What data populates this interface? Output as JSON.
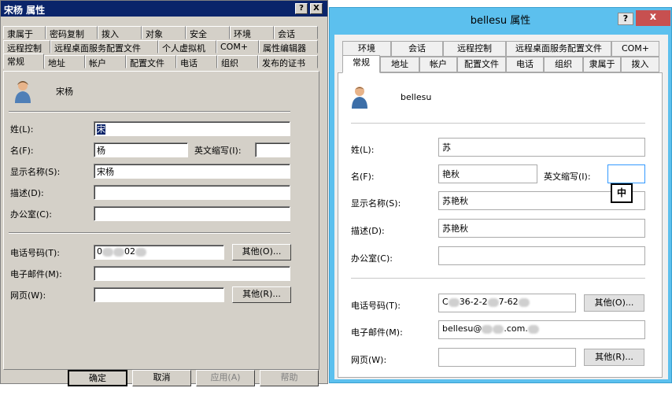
{
  "left": {
    "title": "宋杨 属性",
    "help_btn": "?",
    "close_btn": "X",
    "tabs_row1": [
      "隶属于",
      "密码复制",
      "拨入",
      "对象",
      "安全",
      "环境",
      "会话"
    ],
    "tabs_row2": [
      "远程控制",
      "远程桌面服务配置文件",
      "个人虚拟机",
      "COM+",
      "属性编辑器"
    ],
    "tabs_row3": [
      "常规",
      "地址",
      "帐户",
      "配置文件",
      "电话",
      "组织",
      "发布的证书"
    ],
    "display_name": "宋杨",
    "labels": {
      "last": "姓(L):",
      "first": "名(F):",
      "initials": "英文缩写(I):",
      "display": "显示名称(S):",
      "desc": "描述(D):",
      "office": "办公室(C):",
      "phone": "电话号码(T):",
      "email": "电子邮件(M):",
      "web": "网页(W):"
    },
    "values": {
      "last": "宋",
      "first": "杨",
      "initials": "",
      "display": "宋杨",
      "desc": "",
      "office": "",
      "phone_a": "0",
      "phone_b": "02",
      "email": "",
      "web": ""
    },
    "other1": "其他(O)...",
    "other2": "其他(R)...",
    "bottom_buttons": [
      "确定",
      "取消",
      "应用(A)",
      "帮助"
    ]
  },
  "right": {
    "title": "bellesu 属性",
    "help_btn": "?",
    "close_btn": "x",
    "tabs_row1": [
      "环境",
      "会话",
      "远程控制",
      "远程桌面服务配置文件",
      "COM+"
    ],
    "tabs_row2": [
      "常规",
      "地址",
      "帐户",
      "配置文件",
      "电话",
      "组织",
      "隶属于",
      "拨入"
    ],
    "display_name": "bellesu",
    "labels": {
      "last": "姓(L):",
      "first": "名(F):",
      "initials": "英文缩写(I):",
      "display": "显示名称(S):",
      "desc": "描述(D):",
      "office": "办公室(C):",
      "phone": "电话号码(T):",
      "email": "电子邮件(M):",
      "web": "网页(W):"
    },
    "values": {
      "last": "苏",
      "first": "艳秋",
      "initials": "",
      "display": "苏艳秋",
      "desc": "苏艳秋",
      "office": "",
      "phone_a": "C",
      "phone_b": "36-2-2",
      "phone_c": "7-62",
      "email_a": "bellesu@",
      "email_b": ".com.",
      "web": ""
    },
    "ime_badge": "中",
    "other1": "其他(O)...",
    "other2": "其他(R)..."
  }
}
